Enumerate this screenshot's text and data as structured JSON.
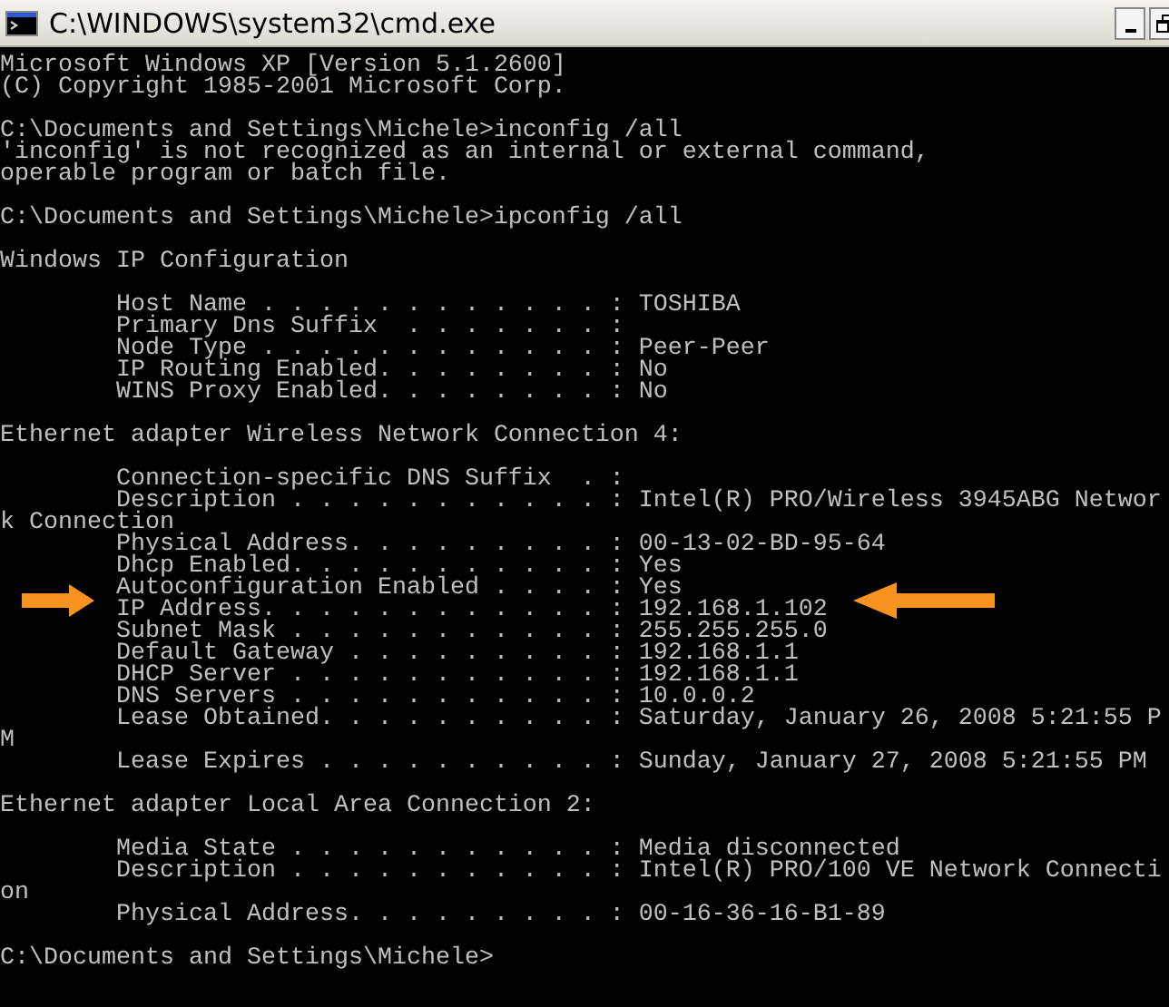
{
  "window": {
    "title": "C:\\WINDOWS\\system32\\cmd.exe"
  },
  "console_blocks": [
    [
      "Microsoft Windows XP [Version 5.1.2600]",
      "(C) Copyright 1985-2001 Microsoft Corp."
    ],
    [
      "C:\\Documents and Settings\\Michele>inconfig /all",
      "'inconfig' is not recognized as an internal or external command,",
      "operable program or batch file."
    ],
    [
      "C:\\Documents and Settings\\Michele>ipconfig /all"
    ],
    [
      "Windows IP Configuration"
    ],
    [
      "        Host Name . . . . . . . . . . . . : TOSHIBA",
      "        Primary Dns Suffix  . . . . . . . :",
      "        Node Type . . . . . . . . . . . . : Peer-Peer",
      "        IP Routing Enabled. . . . . . . . : No",
      "        WINS Proxy Enabled. . . . . . . . : No"
    ],
    [
      "Ethernet adapter Wireless Network Connection 4:"
    ],
    [
      "        Connection-specific DNS Suffix  . :",
      "        Description . . . . . . . . . . . : Intel(R) PRO/Wireless 3945ABG Networ",
      "k Connection",
      "        Physical Address. . . . . . . . . : 00-13-02-BD-95-64",
      "        Dhcp Enabled. . . . . . . . . . . : Yes",
      "        Autoconfiguration Enabled . . . . : Yes",
      "        IP Address. . . . . . . . . . . . : 192.168.1.102",
      "        Subnet Mask . . . . . . . . . . . : 255.255.255.0",
      "        Default Gateway . . . . . . . . . : 192.168.1.1",
      "        DHCP Server . . . . . . . . . . . : 192.168.1.1",
      "        DNS Servers . . . . . . . . . . . : 10.0.0.2",
      "        Lease Obtained. . . . . . . . . . : Saturday, January 26, 2008 5:21:55 P",
      "M",
      "        Lease Expires . . . . . . . . . . : Sunday, January 27, 2008 5:21:55 PM"
    ],
    [
      "Ethernet adapter Local Area Connection 2:"
    ],
    [
      "        Media State . . . . . . . . . . . : Media disconnected",
      "        Description . . . . . . . . . . . : Intel(R) PRO/100 VE Network Connecti",
      "on",
      "        Physical Address. . . . . . . . . : 00-16-36-16-B1-89"
    ],
    [
      "C:\\Documents and Settings\\Michele>"
    ]
  ]
}
